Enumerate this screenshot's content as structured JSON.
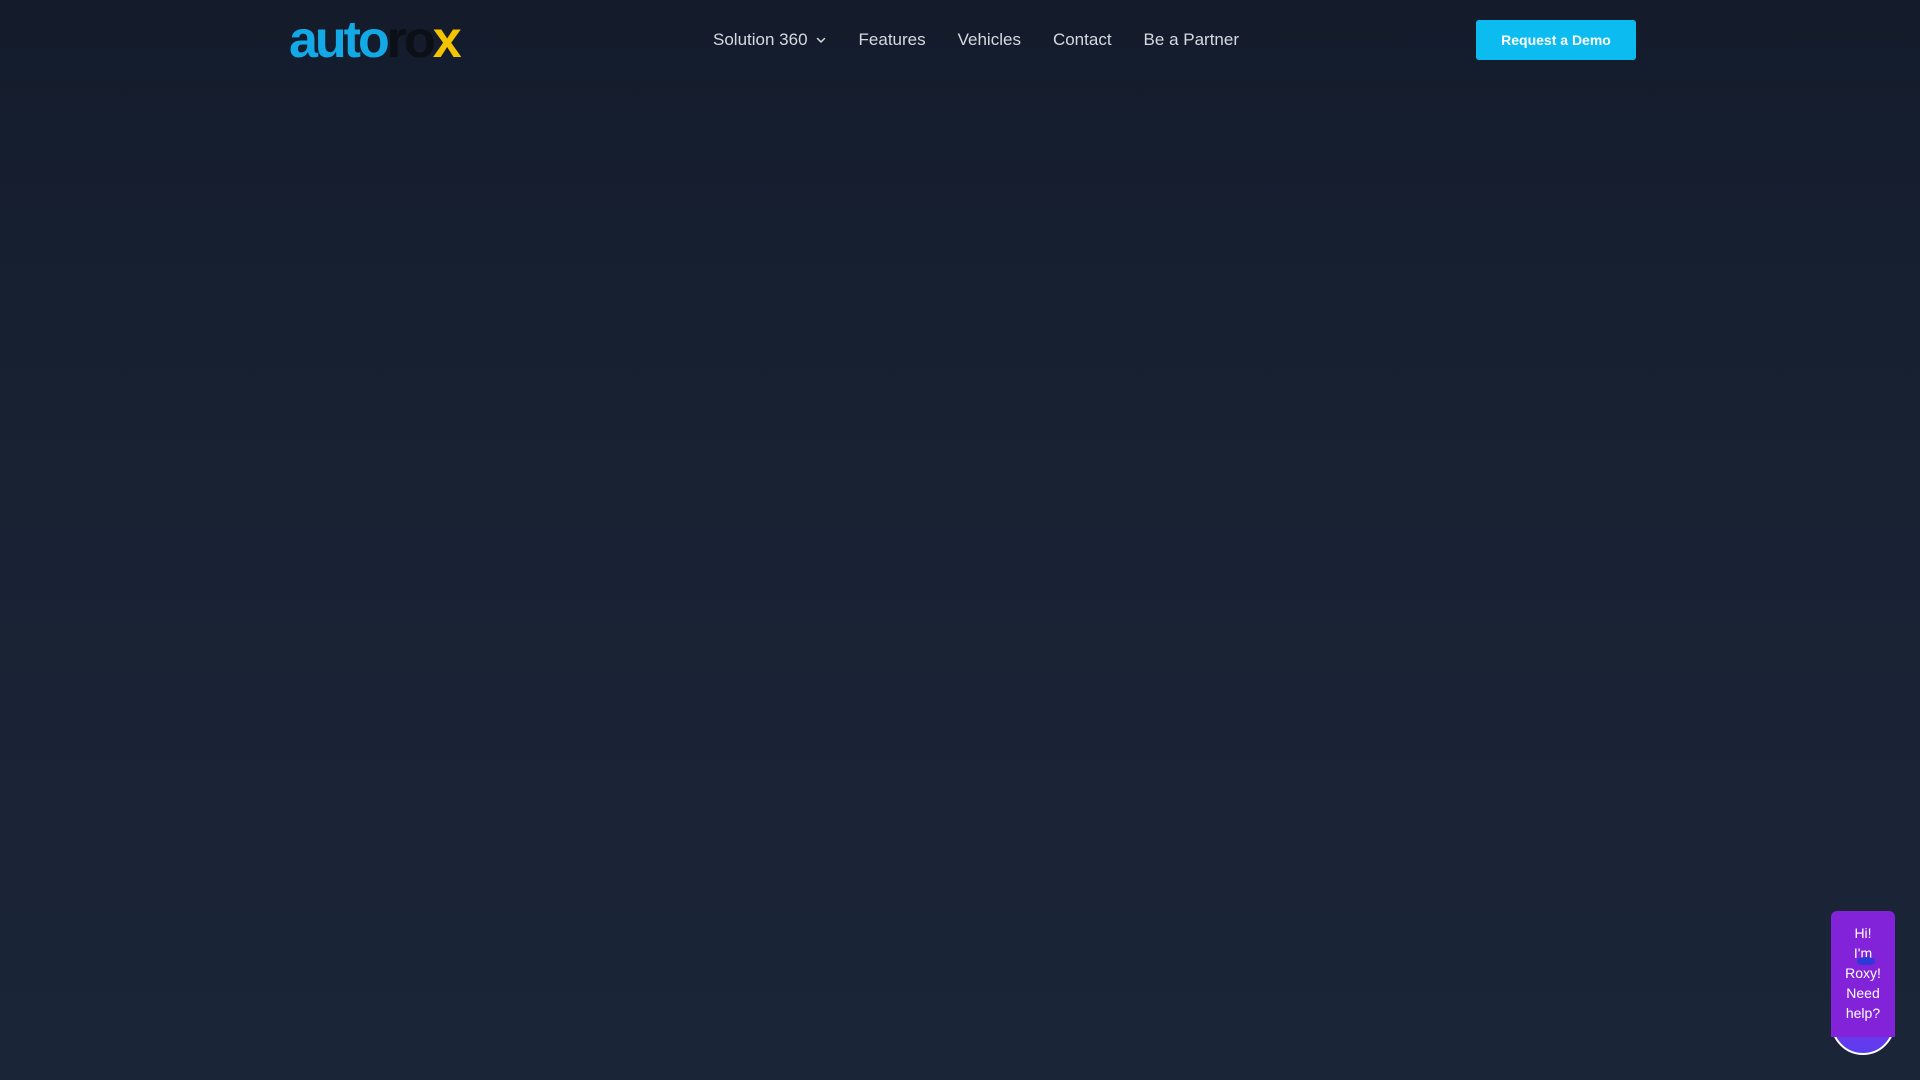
{
  "brand": {
    "logo_part_a": "auto",
    "logo_part_b": "ro",
    "logo_part_c": "x",
    "colors": {
      "blue": "#12a9e6",
      "dark": "#0b0f16",
      "yellow": "#f5c400"
    }
  },
  "nav": {
    "items": [
      {
        "label": "Solution 360",
        "has_dropdown": true,
        "icon": "chevron-down-icon"
      },
      {
        "label": "Features"
      },
      {
        "label": "Vehicles"
      },
      {
        "label": "Contact"
      },
      {
        "label": "Be a Partner"
      }
    ]
  },
  "cta": {
    "label": "Request a Demo",
    "color": "#0cbcf1"
  },
  "chat": {
    "line1": "Hi!",
    "line2": "I'm",
    "line3": "Roxy!",
    "line4": "Need",
    "line5": "help?",
    "color": "#8323d9",
    "icon": "chat-avatar-icon"
  },
  "theme": {
    "background": "#182233"
  }
}
